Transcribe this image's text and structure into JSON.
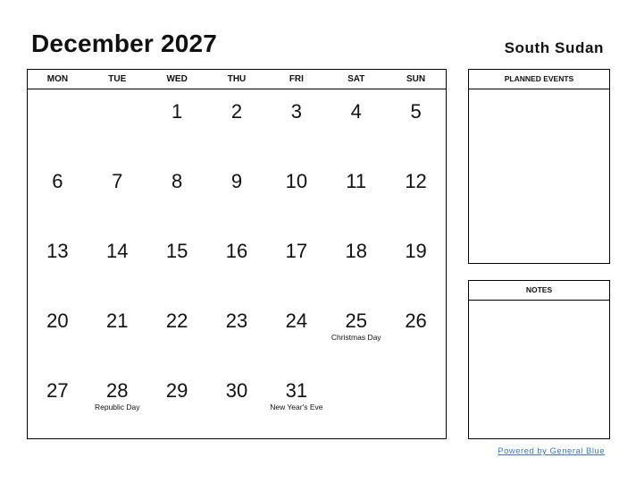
{
  "header": {
    "title": "December 2027",
    "country": "South Sudan"
  },
  "weekdays": [
    "MON",
    "TUE",
    "WED",
    "THU",
    "FRI",
    "SAT",
    "SUN"
  ],
  "weeks": [
    [
      {
        "d": ""
      },
      {
        "d": ""
      },
      {
        "d": "1"
      },
      {
        "d": "2"
      },
      {
        "d": "3"
      },
      {
        "d": "4"
      },
      {
        "d": "5"
      }
    ],
    [
      {
        "d": "6"
      },
      {
        "d": "7"
      },
      {
        "d": "8"
      },
      {
        "d": "9"
      },
      {
        "d": "10"
      },
      {
        "d": "11"
      },
      {
        "d": "12"
      }
    ],
    [
      {
        "d": "13"
      },
      {
        "d": "14"
      },
      {
        "d": "15"
      },
      {
        "d": "16"
      },
      {
        "d": "17"
      },
      {
        "d": "18"
      },
      {
        "d": "19"
      }
    ],
    [
      {
        "d": "20"
      },
      {
        "d": "21"
      },
      {
        "d": "22"
      },
      {
        "d": "23"
      },
      {
        "d": "24"
      },
      {
        "d": "25",
        "h": "Christmas Day"
      },
      {
        "d": "26"
      }
    ],
    [
      {
        "d": "27"
      },
      {
        "d": "28",
        "h": "Republic Day"
      },
      {
        "d": "29"
      },
      {
        "d": "30"
      },
      {
        "d": "31",
        "h": "New Year's Eve"
      },
      {
        "d": ""
      },
      {
        "d": ""
      }
    ]
  ],
  "panels": {
    "planned_events": "PLANNED EVENTS",
    "notes": "NOTES"
  },
  "footer": {
    "link": "Powered by General Blue",
    "color": "#3b78c2"
  }
}
